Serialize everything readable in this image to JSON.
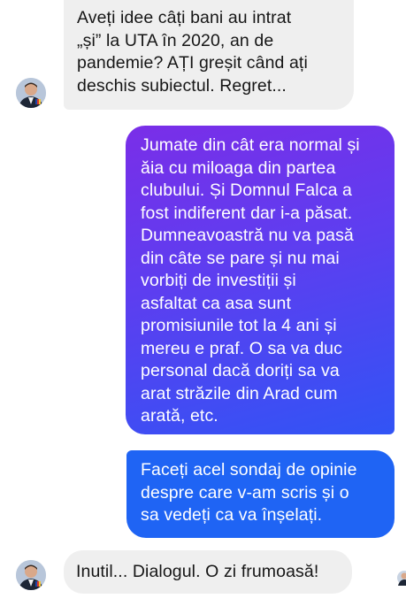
{
  "conversation": {
    "messages": [
      {
        "sender": "contact",
        "text": "Aveți idee câți bani au intrat\n„și” la UTA în 2020, an de\npandemie? AȚI greșit când ați\ndeschis subiectul. Regret..."
      },
      {
        "sender": "me",
        "text": "Jumate din cât era normal și\năia cu miloaga din partea\nclubului. Și Domnul Falca a\nfost indiferent dar i-a păsat.\nDumneavoastră nu va pasă\ndin câte se pare și nu mai\nvorbiți de investiții și\nasfaltat ca asa sunt\npromisiunile tot la 4 ani și\nmereu e praf. O sa va duc\npersonal dacă doriți sa va\narat străzile din Arad cum\narată, etc."
      },
      {
        "sender": "me",
        "text": "Faceți acel sondaj de opinie\ndespre care v-am scris și o\nsa vedeți ca va înșelați."
      },
      {
        "sender": "contact",
        "text": "Inutil... Dialogul. O zi frumoasă!"
      }
    ]
  },
  "colors": {
    "incoming_bubble": "#efefef",
    "outgoing_gradient_start": "#7a2ee8",
    "outgoing_gradient_end": "#3154f5",
    "outgoing_blue": "#1f64f4"
  },
  "icons": {
    "avatar": "contact-avatar-icon",
    "corner": "seen-avatar-icon"
  }
}
